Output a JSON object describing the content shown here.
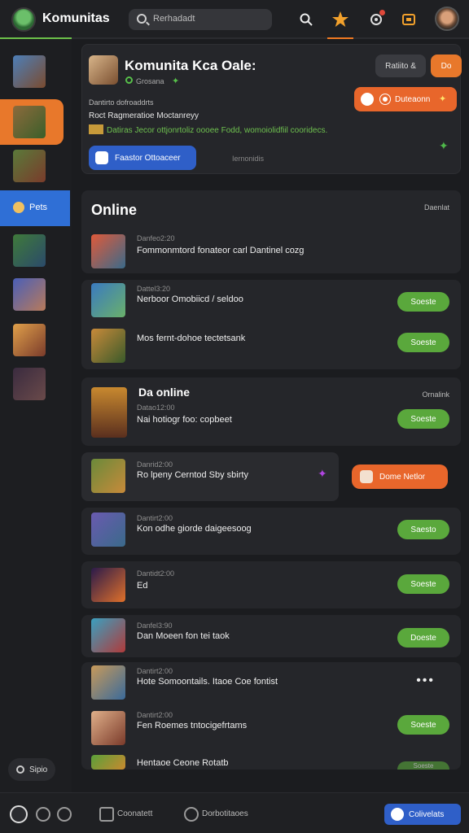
{
  "topbar": {
    "brand_name": "Komunitas",
    "search_placeholder": "Rerhadadt",
    "icons": [
      "search-icon",
      "star-icon",
      "rocket-icon",
      "gamepad-icon"
    ]
  },
  "sidebar": {
    "active_label": "Pets",
    "footer_label": "Sipio"
  },
  "header": {
    "title": "Komunita Kca Oale:",
    "subtitle": "Grosana",
    "gray_button": "Ratiito &",
    "orange_small_button": "Do",
    "orange_button": "Duteaonn",
    "meta1": "Dantirto dofroaddrts",
    "meta2": "Roct Ragmeratioe Moctanreyy",
    "meta3": "Datiras Jecor ottjonrtoliz oooee Fodd, womoiolidfiil cooridecs.",
    "blue_button": "Faastor Ottoaceer",
    "link": "Iernonidis"
  },
  "online_section": {
    "title": "Online",
    "right_label": "Daenlat",
    "first_meta": "Danfeo2:20",
    "first_text": "Fommonmtord fonateor carl Dantinel cozg"
  },
  "rows_group1": [
    {
      "meta": "Dattel3:20",
      "text": "Nerboor Omobiicd / seldoo",
      "button": "Soeste"
    },
    {
      "meta": "",
      "text": "Mos fernt-dohoe tectetsank",
      "button": "Soeste"
    }
  ],
  "da_online": {
    "title": "Da online",
    "right_label": "Ornalink",
    "meta": "Datao12:00",
    "text": "Nai hotiogr foo: copbeet",
    "button": "Soeste"
  },
  "game_row": {
    "meta": "Danrid2:00",
    "text": "Ro lpeny Cerntod Sby sbirty",
    "button": "Dome Netlor"
  },
  "rows_group2": [
    {
      "meta": "Dantirt2:00",
      "text": "Kon odhe giorde daigeesoog",
      "button": "Saesto"
    },
    {
      "meta": "Dantidt2:00",
      "text": "Ed",
      "button": "Soeste"
    },
    {
      "meta": "Danfel3:90",
      "text": "Dan Moeen fon tei taok",
      "button": "Doeste"
    }
  ],
  "rows_group3": [
    {
      "meta": "Dantirt2:00",
      "text": "Hote Somoontails. Itaoe Coe fontist",
      "button": ""
    },
    {
      "meta": "Dantirt2:00",
      "text": "Fen Roemes tntocigefrtams",
      "button": "Soeste"
    },
    {
      "meta": "",
      "text": "Hentaoe Ceone Rotatb",
      "button": "Soeste"
    }
  ],
  "bottombar": {
    "label1": "Coonatett",
    "label2": "Dorbotitaoes",
    "button": "Colivelats"
  }
}
